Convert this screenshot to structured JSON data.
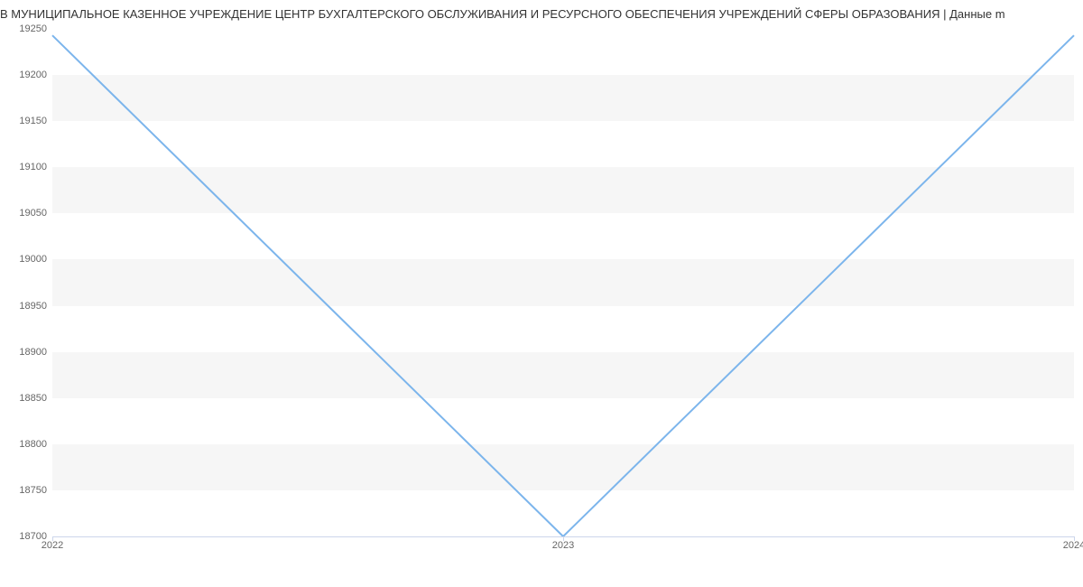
{
  "chart_data": {
    "type": "line",
    "title": "В МУНИЦИПАЛЬНОЕ КАЗЕННОЕ УЧРЕЖДЕНИЕ ЦЕНТР БУХГАЛТЕРСКОГО ОБСЛУЖИВАНИЯ И РЕСУРСНОГО ОБЕСПЕЧЕНИЯ УЧРЕЖДЕНИЙ СФЕРЫ ОБРАЗОВАНИЯ | Данные m",
    "x": [
      "2022",
      "2023",
      "2024"
    ],
    "values": [
      19243,
      18700,
      19243
    ],
    "xlabel": "",
    "ylabel": "",
    "ylim": [
      18700,
      19250
    ],
    "y_ticks": [
      18700,
      18750,
      18800,
      18850,
      18900,
      18950,
      19000,
      19050,
      19100,
      19150,
      19200,
      19250
    ],
    "x_ticks": [
      "2022",
      "2023",
      "2024"
    ],
    "line_color": "#7cb5ec"
  }
}
